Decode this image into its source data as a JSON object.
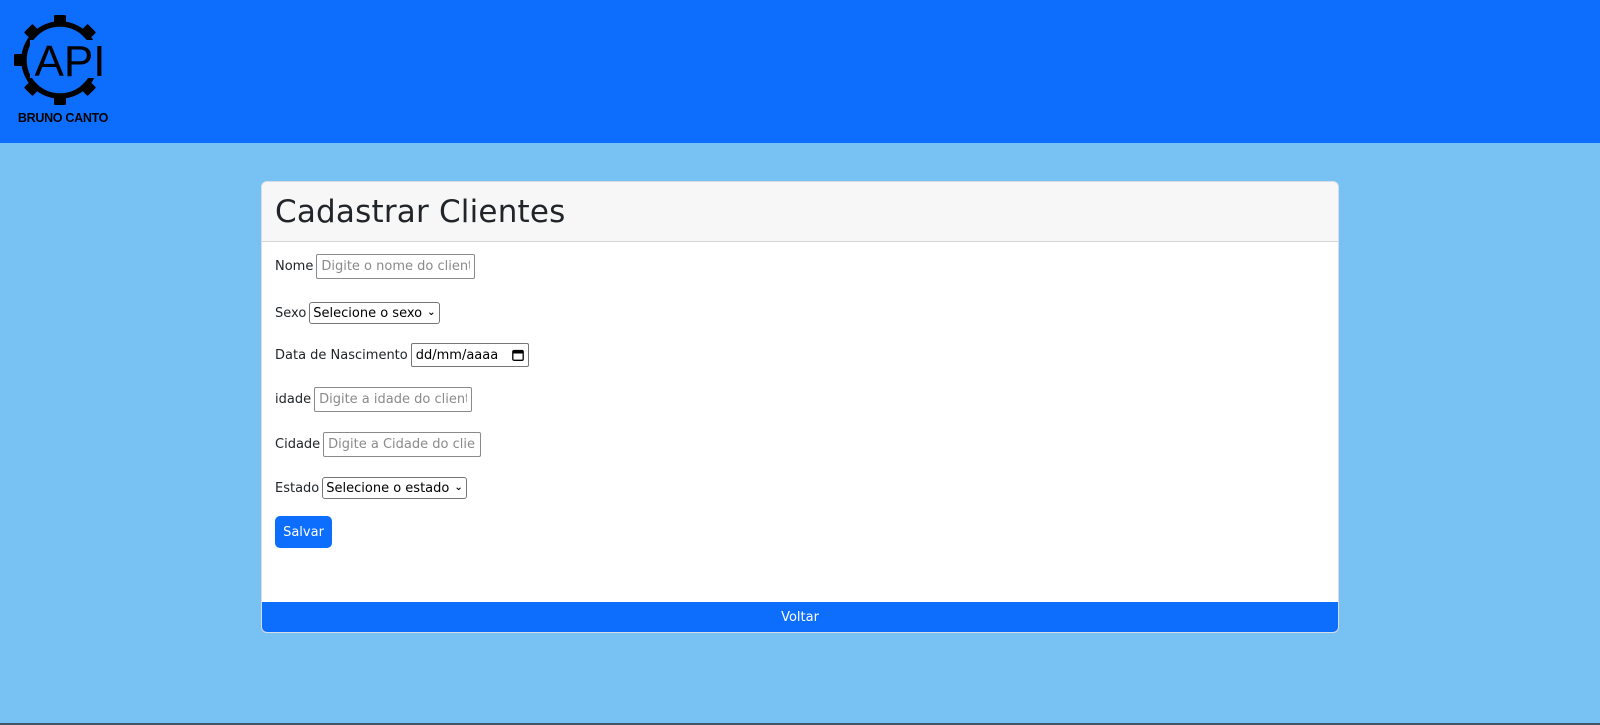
{
  "header": {
    "logo_text": "API",
    "logo_caption": "BRUNO CANTO"
  },
  "form": {
    "title": "Cadastrar Clientes",
    "nome": {
      "label": "Nome",
      "placeholder": "Digite o nome do cliente"
    },
    "sexo": {
      "label": "Sexo",
      "selected": "Selecione o sexo"
    },
    "nascimento": {
      "label": "Data de Nascimento",
      "value": "dd/mm/aaaa"
    },
    "idade": {
      "label": "idade",
      "placeholder": "Digite a idade do cliente"
    },
    "cidade": {
      "label": "Cidade",
      "placeholder": "Digite a Cidade do cliente"
    },
    "estado": {
      "label": "Estado",
      "selected": "Selecione o estado"
    },
    "save_label": "Salvar",
    "back_label": "Voltar"
  },
  "colors": {
    "header_bg": "#0d6efd",
    "page_bg": "#77c1f3",
    "button_bg": "#0d6efd"
  }
}
